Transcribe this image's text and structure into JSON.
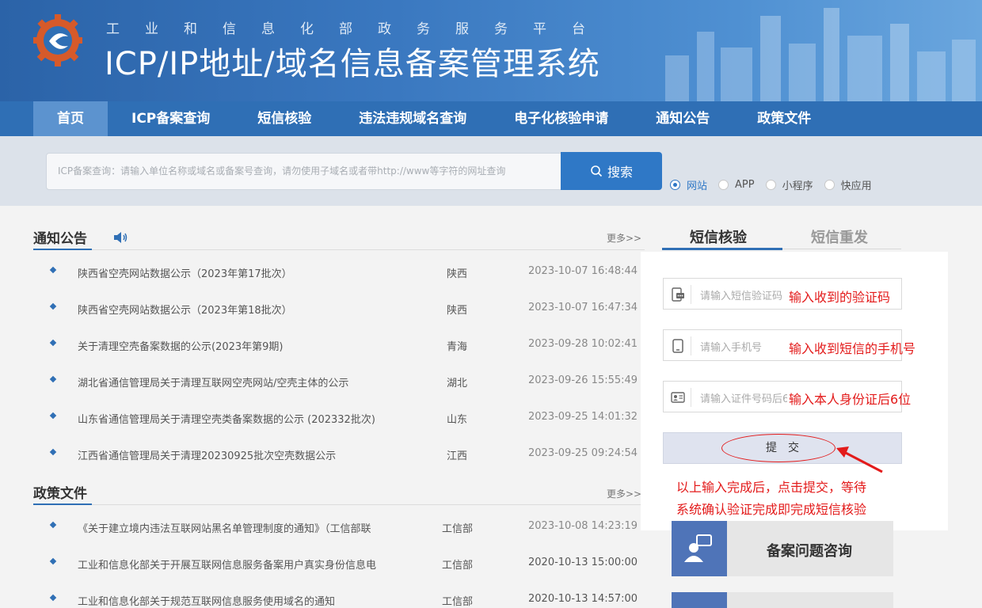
{
  "header": {
    "subtitle": "工业和信息化部政务服务平台",
    "title": "ICP/IP地址/域名信息备案管理系统"
  },
  "nav": {
    "items": [
      {
        "label": "首页",
        "active": true
      },
      {
        "label": "ICP备案查询"
      },
      {
        "label": "短信核验"
      },
      {
        "label": "违法违规域名查询"
      },
      {
        "label": "电子化核验申请"
      },
      {
        "label": "通知公告"
      },
      {
        "label": "政策文件"
      }
    ]
  },
  "search": {
    "placeholder": "ICP备案查询：请输入单位名称或域名或备案号查询，请勿使用子域名或者带http://www等字符的网址查询",
    "button_label": "搜索",
    "options": [
      {
        "label": "网站",
        "checked": true
      },
      {
        "label": "APP"
      },
      {
        "label": "小程序"
      },
      {
        "label": "快应用"
      }
    ]
  },
  "notices": {
    "title": "通知公告",
    "more": "更多>>",
    "rows": [
      {
        "title": "陕西省空壳网站数据公示（2023年第17批次）",
        "province": "陕西",
        "date": "2023-10-07 16:48:44"
      },
      {
        "title": "陕西省空壳网站数据公示（2023年第18批次）",
        "province": "陕西",
        "date": "2023-10-07 16:47:34"
      },
      {
        "title": "关于清理空壳备案数据的公示(2023年第9期)",
        "province": "青海",
        "date": "2023-09-28 10:02:41"
      },
      {
        "title": "湖北省通信管理局关于清理互联网空壳网站/空壳主体的公示",
        "province": "湖北",
        "date": "2023-09-26 15:55:49"
      },
      {
        "title": "山东省通信管理局关于清理空壳类备案数据的公示 (202332批次)",
        "province": "山东",
        "date": "2023-09-25 14:01:32"
      },
      {
        "title": "江西省通信管理局关于清理20230925批次空壳数据公示",
        "province": "江西",
        "date": "2023-09-25 09:24:54"
      }
    ]
  },
  "policies": {
    "title": "政策文件",
    "more": "更多>>",
    "rows": [
      {
        "title": "《关于建立境内违法互联网站黑名单管理制度的通知》（工信部联",
        "province": "工信部",
        "date": "2023-10-08 14:23:19"
      },
      {
        "title": "工业和信息化部关于开展互联网信息服务备案用户真实身份信息电",
        "province": "工信部",
        "date": "2020-10-13 15:00:00"
      },
      {
        "title": "工业和信息化部关于规范互联网信息服务使用域名的通知",
        "province": "工信部",
        "date": "2020-10-13 14:57:00"
      }
    ]
  },
  "sms": {
    "tab_verify": "短信核验",
    "tab_resend": "短信重发",
    "code_placeholder": "请输入短信验证码",
    "code_hint": "输入收到的验证码",
    "phone_placeholder": "请输入手机号",
    "phone_hint": "输入收到短信的手机号",
    "id_placeholder": "请输入证件号码后6位",
    "id_hint": "输入本人身份证后6位",
    "submit_label": "提交",
    "note_line1": "以上输入完成后，点击提交，等待",
    "note_line2": "系统确认验证完成即完成短信核验"
  },
  "consult": {
    "label": "备案问题咨询"
  },
  "colors": {
    "primary": "#2f6fb5",
    "annotation": "#e31b1b"
  }
}
